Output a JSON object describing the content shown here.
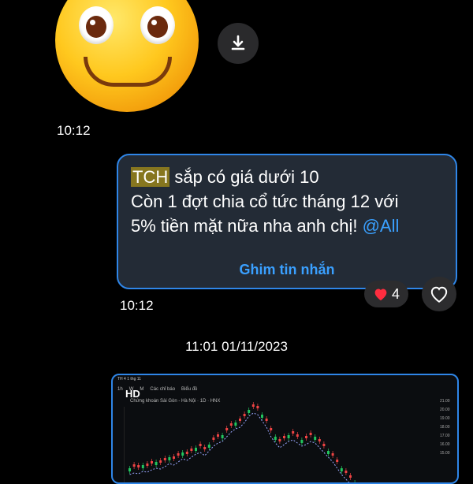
{
  "message1": {
    "time": "10:12"
  },
  "message2": {
    "lines": [
      {
        "highlight": "TCH",
        "text": " sắp có giá dưới 10"
      },
      {
        "text": "Còn 1 đợt chia cổ tức tháng 12 với"
      },
      {
        "text": "5% tiền mặt nữa nha anh chị! ",
        "mention": "@All"
      }
    ],
    "pin_label": "Ghim tin nhắn",
    "time": "10:12",
    "reaction_count": "4"
  },
  "date_separator": "11:01 01/11/2023",
  "attachment": {
    "badge": "HD",
    "status_left": "TH 4 1 thg 11",
    "toolbar": [
      "1h",
      "W",
      "M",
      "Các chỉ báo",
      "Biểu đồ"
    ],
    "chart_title": "Chứng khoán Sài Gòn - Hà Nội · 1D · HNX",
    "price_axis": [
      "21.00",
      "20.00",
      "19.00",
      "18.00",
      "17.00",
      "16.00",
      "15.00"
    ]
  },
  "colors": {
    "accent": "#2f86e8",
    "mention": "#3aa0ff",
    "bubble": "#232b36",
    "highlight": "#86761f"
  },
  "icons": {
    "download": "download-icon",
    "heart": "heart-outline-icon",
    "reaction": "red-heart-icon"
  }
}
